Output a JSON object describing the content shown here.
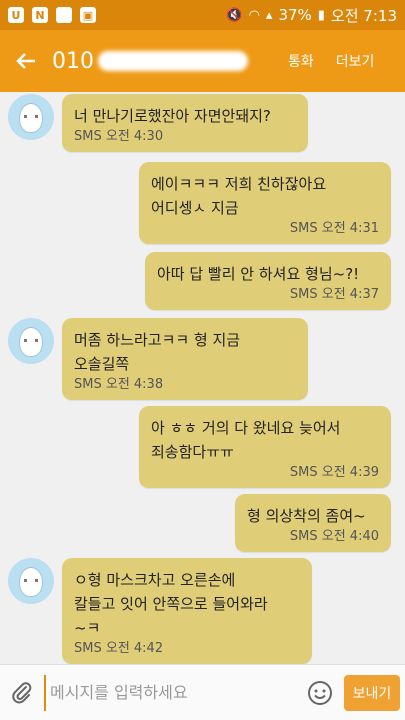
{
  "status_bar": {
    "battery": "37%",
    "time": "오전 7:13",
    "icons": [
      "u-app-icon",
      "n-app-icon",
      "blank-app-icon",
      "image-icon",
      "mute-icon",
      "wifi-icon",
      "signal-icon",
      "battery-icon"
    ]
  },
  "header": {
    "number_prefix": "010",
    "call_label": "통화",
    "more_label": "더보기"
  },
  "messages": [
    {
      "dir": "in",
      "text": "너 만나기로했잔아 자면안돼지?",
      "meta": "SMS 오전 4:30"
    },
    {
      "dir": "out",
      "text": "에이ㅋㅋㅋ 저희 친하잖아요\n어디셍ㅅ 지금",
      "meta": "SMS 오전 4:31"
    },
    {
      "dir": "out",
      "text": "아따 답 빨리 안 하셔요 형님~?!",
      "meta": "SMS 오전 4:37"
    },
    {
      "dir": "in",
      "text": "머좀 하느라고ㅋㅋ  형 지금\n오솔길쪽",
      "meta": "SMS 오전 4:38"
    },
    {
      "dir": "out",
      "text": "아 ㅎㅎ 거의 다 왔네요 늦어서\n죄송함다ㅠㅠ",
      "meta": "SMS 오전 4:39"
    },
    {
      "dir": "out",
      "text": "형 의상착의 좀여~",
      "meta": "SMS 오전 4:40"
    },
    {
      "dir": "in",
      "text": "ㅇ형 마스크차고 오른손에\n칼들고 잇어 안쪽으로 들어와라\n~ㅋ",
      "meta": "SMS 오전 4:42"
    }
  ],
  "composer": {
    "placeholder": "메시지를 입력하세요",
    "send_label": "보내기"
  },
  "colors": {
    "status_bar": "#d9860a",
    "app_bar": "#ef9a17",
    "bubble": "#e0cd78",
    "background": "#f0f0f0"
  }
}
